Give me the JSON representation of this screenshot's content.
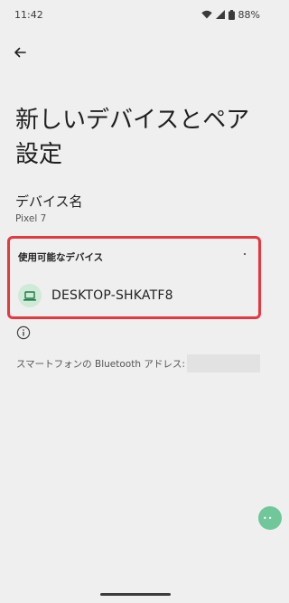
{
  "status_bar": {
    "time": "11:42",
    "battery": "88%",
    "icons": [
      "wifi-icon",
      "signal-icon",
      "battery-icon"
    ]
  },
  "header": {
    "back_icon": "arrow-left-icon",
    "title": "新しいデバイスとペア設定"
  },
  "device_name": {
    "title": "デバイス名",
    "value": "Pixel 7"
  },
  "available_devices": {
    "heading": "使用可能なデバイス",
    "highlight_color": "#e6383f",
    "items": [
      {
        "label": "DESKTOP-SHKATF8",
        "icon": "laptop-icon",
        "icon_bg": "#cfead8",
        "icon_color": "#1e7a45"
      }
    ]
  },
  "info": {
    "icon": "info-icon",
    "bt_address_label": "スマートフォンの Bluetooth アドレス:"
  },
  "colors": {
    "background": "#efefef",
    "accent_green": "#6fc79a"
  }
}
